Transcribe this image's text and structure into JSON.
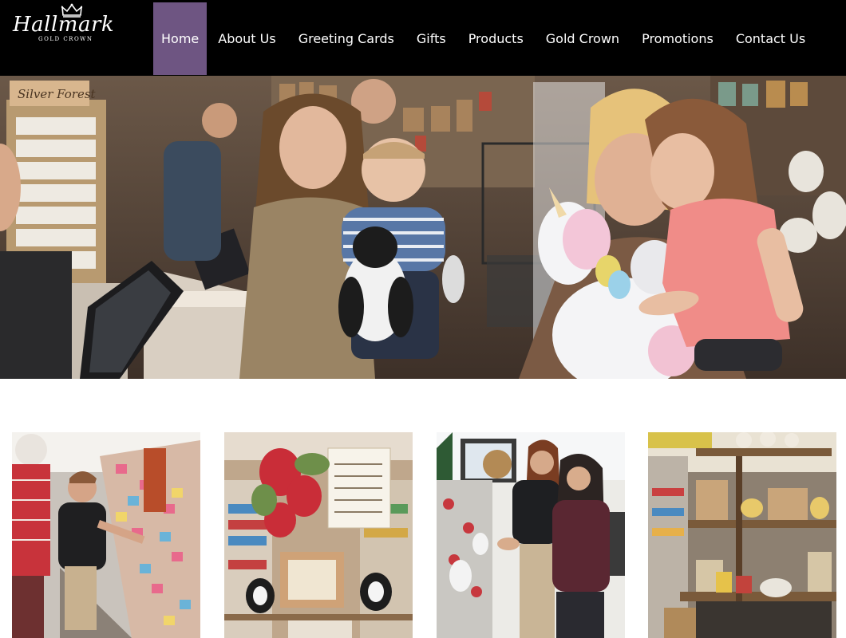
{
  "brand": {
    "name": "Hallmark",
    "tagline": "GOLD CROWN"
  },
  "nav": {
    "items": [
      {
        "label": "Home",
        "active": true
      },
      {
        "label": "About Us",
        "active": false
      },
      {
        "label": "Greeting Cards",
        "active": false
      },
      {
        "label": "Gifts",
        "active": false
      },
      {
        "label": "Products",
        "active": false
      },
      {
        "label": "Gold Crown",
        "active": false
      },
      {
        "label": "Promotions",
        "active": false
      },
      {
        "label": "Contact Us",
        "active": false
      }
    ]
  },
  "hero": {
    "store_sign": "Silver Forest"
  },
  "colors": {
    "topbar": "#000000",
    "nav_active": "#6e5582",
    "nav_text": "#ffffff",
    "page_bg": "#ffffff"
  }
}
